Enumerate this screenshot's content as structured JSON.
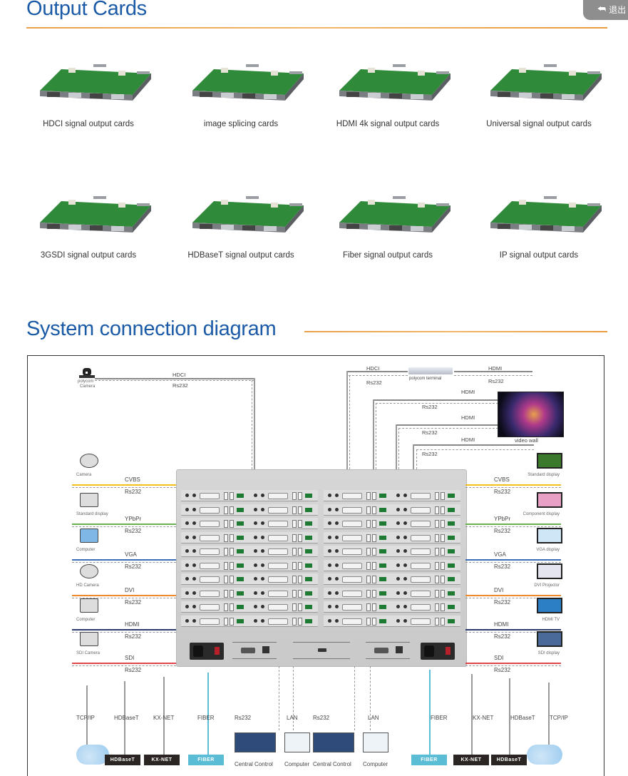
{
  "header": {
    "exit_button": {
      "icon": "reply-arrow-icon",
      "label": "退出"
    }
  },
  "output_cards": {
    "title": "Output Cards",
    "cards": [
      {
        "label": "HDCI signal output cards"
      },
      {
        "label": "image splicing cards"
      },
      {
        "label": "HDMI 4k signal output  cards"
      },
      {
        "label": "Universal signal output cards"
      },
      {
        "label": "3GSDI signal output cards"
      },
      {
        "label": "HDBaseT signal output cards"
      },
      {
        "label": "Fiber signal output cards"
      },
      {
        "label": "IP signal output cards"
      }
    ]
  },
  "diagram": {
    "title": "System connection diagram",
    "top_left": {
      "device": "polycom",
      "device_sub": "Camera",
      "signal": "HDCI",
      "control": "Rs232"
    },
    "top_right": {
      "terminal": "polycom terminal",
      "video_wall": "video wall",
      "hdci_label": "HDCI",
      "links": [
        {
          "signal": "HDMI",
          "control": "Rs232"
        },
        {
          "signal": "HDMI",
          "control": "Rs232"
        },
        {
          "signal": "HDMI",
          "control": "Rs232"
        },
        {
          "signal": "HDMI",
          "control": "Rs232"
        }
      ],
      "hdci_control": "Rs232"
    },
    "inputs": [
      {
        "device": "Camera",
        "signal": "CVBS",
        "control": "Rs232",
        "color": "#f2c018"
      },
      {
        "device": "Standard display",
        "signal": "YPbPr",
        "control": "Rs232",
        "color": "#6ab04c"
      },
      {
        "device": "Computer",
        "signal": "VGA",
        "control": "Rs232",
        "color": "#3a6fb5"
      },
      {
        "device": "HD Camera",
        "signal": "DVI",
        "control": "Rs232",
        "color": "#ee8a2a"
      },
      {
        "device": "Computer",
        "signal": "HDMI",
        "control": "Rs232",
        "color": "#2b3b6b"
      },
      {
        "device": "SDI Camera",
        "signal": "SDI",
        "control": "Rs232",
        "color": "#e0474c"
      }
    ],
    "outputs": [
      {
        "device": "Standard display",
        "signal": "CVBS",
        "control": "Rs232",
        "color": "#f2c018"
      },
      {
        "device": "Component display",
        "signal": "YPbPr",
        "control": "Rs232",
        "color": "#6ab04c"
      },
      {
        "device": "VGA display",
        "signal": "VGA",
        "control": "Rs232",
        "color": "#3a6fb5"
      },
      {
        "device": "DVI Projector",
        "signal": "DVI",
        "control": "Rs232",
        "color": "#ee8a2a"
      },
      {
        "device": "HDMI TV",
        "signal": "HDMI",
        "control": "Rs232",
        "color": "#2b3b6b"
      },
      {
        "device": "SDI display",
        "signal": "SDI",
        "control": "Rs232",
        "color": "#e0474c"
      }
    ],
    "bottom_left": [
      {
        "link": "TCP/IP",
        "box": ""
      },
      {
        "link": "HDBaseT",
        "box": "HDBaseT"
      },
      {
        "link": "KX-NET",
        "box": "KX-NET"
      },
      {
        "link": "FIBER",
        "box": "FIBER"
      }
    ],
    "bottom_center": [
      {
        "link": "Rs232",
        "device": "Central Control"
      },
      {
        "link": "LAN",
        "device": "Computer"
      },
      {
        "link": "Rs232",
        "device": "Central Control"
      },
      {
        "link": "LAN",
        "device": "Computer"
      }
    ],
    "bottom_right": [
      {
        "link": "FIBER",
        "box": "FIBER"
      },
      {
        "link": "KX-NET",
        "box": "KX-NET"
      },
      {
        "link": "HDBaseT",
        "box": "HDBaseT"
      },
      {
        "link": "TCP/IP",
        "box": ""
      }
    ],
    "colors": {
      "fiber": "#5bbcd6",
      "dark_box": "#2a2523",
      "title_blue": "#1a5aa6",
      "rule_orange": "#e9a04a"
    }
  }
}
